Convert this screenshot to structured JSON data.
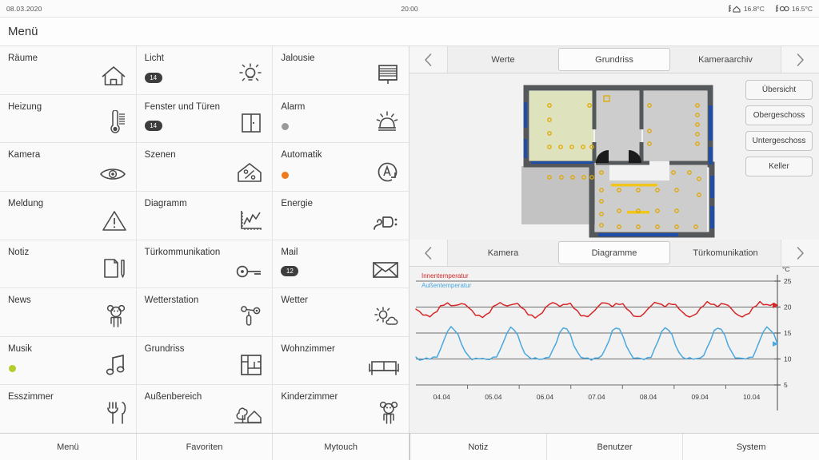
{
  "statusbar": {
    "date": "08.03.2020",
    "clock": "20:00",
    "sensors": [
      {
        "icon": "house-temp-icon",
        "value": "16.8°C"
      },
      {
        "icon": "outdoor-temp-icon",
        "value": "16.5°C"
      }
    ]
  },
  "header": {
    "title": "Menü"
  },
  "menu": {
    "columns": [
      {
        "items": [
          {
            "label": "Räume",
            "icon": "house-icon"
          },
          {
            "label": "Heizung",
            "icon": "thermometer-icon"
          },
          {
            "label": "Kamera",
            "icon": "eye-icon"
          },
          {
            "label": "Meldung",
            "icon": "warning-triangle-icon"
          },
          {
            "label": "Notiz",
            "icon": "note-pencil-icon"
          },
          {
            "label": "News",
            "icon": "teddy-bear-icon"
          },
          {
            "label": "Musik",
            "icon": "music-note-icon",
            "dot": "#b5cc2a"
          },
          {
            "label": "Esszimmer",
            "icon": "cutlery-icon"
          }
        ]
      },
      {
        "items": [
          {
            "label": "Licht",
            "icon": "lightbulb-icon",
            "badge": "14"
          },
          {
            "label": "Fenster und Türen",
            "icon": "window-icon",
            "badge": "14"
          },
          {
            "label": "Szenen",
            "icon": "house-percent-icon"
          },
          {
            "label": "Diagramm",
            "icon": "chart-icon"
          },
          {
            "label": "Türkommunikation",
            "icon": "key-icon"
          },
          {
            "label": "Wetterstation",
            "icon": "anemometer-icon"
          },
          {
            "label": "Grundriss",
            "icon": "floorplan-icon"
          },
          {
            "label": "Außenbereich",
            "icon": "tree-house-icon"
          }
        ]
      },
      {
        "items": [
          {
            "label": "Jalousie",
            "icon": "blinds-icon"
          },
          {
            "label": "Alarm",
            "icon": "alarm-bell-icon",
            "dot": "#9a9a9a"
          },
          {
            "label": "Automatik",
            "icon": "automatic-icon",
            "dot": "#f07a18"
          },
          {
            "label": "Energie",
            "icon": "power-plug-icon"
          },
          {
            "label": "Mail",
            "icon": "envelope-icon",
            "badge": "12"
          },
          {
            "label": "Wetter",
            "icon": "sun-cloud-icon"
          },
          {
            "label": "Wohnzimmer",
            "icon": "sofa-icon"
          },
          {
            "label": "Kinderzimmer",
            "icon": "teddy-bear-icon"
          }
        ]
      }
    ]
  },
  "top_panel": {
    "tabs": [
      {
        "label": "Werte",
        "active": false
      },
      {
        "label": "Grundriss",
        "active": true
      },
      {
        "label": "Kameraarchiv",
        "active": false
      }
    ],
    "prev_arrow": "chevron-left-icon",
    "next_arrow": "chevron-right-icon",
    "floor_buttons": [
      {
        "label": "Übersicht"
      },
      {
        "label": "Obergeschoss"
      },
      {
        "label": "Untergeschoss"
      },
      {
        "label": "Keller"
      }
    ],
    "plan": {
      "wall_color": "#55585a",
      "room_fill": "#cdcdcd",
      "room_active_fill": "#dfe3bd",
      "light_marker_color": "#e0a800",
      "window_color": "#1f4ea8",
      "strip_color": "#f0c61e"
    }
  },
  "bottom_panel": {
    "tabs": [
      {
        "label": "Kamera",
        "active": false
      },
      {
        "label": "Diagramme",
        "active": true
      },
      {
        "label": "Türkomunikation",
        "active": false
      }
    ],
    "prev_arrow": "chevron-left-icon",
    "next_arrow": "chevron-right-icon"
  },
  "chart_data": {
    "type": "line",
    "title": "",
    "xlabel": "",
    "ylabel": "°C",
    "unit_label": "°C",
    "legend_position": "top-left",
    "grid": true,
    "ylim": [
      5,
      25
    ],
    "yticks": [
      5,
      10,
      15,
      20,
      25
    ],
    "xticks": [
      "04.04",
      "05.04",
      "06.04",
      "07.04",
      "08.04",
      "09.04",
      "10.04"
    ],
    "series": [
      {
        "name": "Innentemperatur",
        "color": "#d62728",
        "values": [
          19.6,
          19.2,
          18.6,
          18.3,
          18.2,
          18.6,
          19.4,
          20.1,
          20.5,
          20.6,
          20.4,
          20.3,
          20.5,
          20.6,
          20.4,
          20.0,
          19.3,
          18.6,
          18.2,
          18.1,
          18.4,
          19.2,
          20.0,
          20.5,
          20.7,
          20.5,
          20.3,
          20.4,
          20.6,
          20.5,
          20.1,
          19.4,
          18.7,
          18.2,
          18.0,
          18.3,
          19.1,
          19.9,
          20.5,
          20.8,
          20.6,
          20.3,
          20.4,
          20.6,
          20.5,
          20.0,
          19.2,
          18.5,
          18.1,
          18.2,
          18.7,
          19.5,
          20.2,
          20.7,
          20.8,
          20.5,
          20.3,
          20.5,
          20.6,
          20.4,
          19.9,
          19.1,
          18.4,
          18.0,
          18.2,
          18.8,
          19.6,
          20.3,
          20.7,
          20.8,
          20.4,
          20.3,
          20.5,
          20.6,
          20.3,
          19.8,
          19.0,
          18.4,
          18.0,
          18.3,
          18.9,
          19.7,
          20.4,
          20.8,
          20.7,
          20.4,
          20.3,
          20.5,
          20.6,
          20.2,
          19.7,
          18.9,
          18.3,
          18.1,
          18.4,
          19.0,
          19.8,
          20.4,
          20.8,
          20.6,
          20.4,
          20.5,
          20.6,
          20.3
        ]
      },
      {
        "name": "Außentemperatur",
        "color": "#4aa8df",
        "values": [
          10.2,
          10.0,
          9.9,
          10.1,
          10.0,
          10.2,
          10.6,
          11.8,
          13.6,
          15.3,
          16.1,
          15.8,
          14.6,
          12.9,
          11.4,
          10.5,
          10.1,
          10.0,
          10.1,
          10.0,
          9.9,
          10.1,
          10.2,
          10.5,
          11.6,
          13.4,
          15.2,
          16.0,
          15.7,
          14.4,
          12.7,
          11.2,
          10.4,
          10.1,
          10.0,
          10.1,
          10.0,
          10.2,
          10.4,
          11.5,
          13.3,
          15.1,
          16.0,
          15.8,
          14.5,
          12.8,
          11.3,
          10.4,
          10.1,
          10.0,
          10.0,
          10.1,
          10.3,
          10.6,
          11.9,
          13.7,
          15.4,
          16.1,
          15.6,
          14.3,
          12.6,
          11.1,
          10.3,
          10.0,
          10.1,
          10.0,
          10.2,
          10.5,
          11.7,
          13.5,
          15.3,
          16.0,
          15.7,
          14.4,
          12.7,
          11.2,
          10.4,
          10.1,
          10.0,
          10.1,
          10.0,
          10.3,
          10.7,
          12.0,
          13.8,
          15.4,
          16.1,
          15.7,
          14.4,
          12.7,
          11.2,
          10.4,
          10.1,
          10.0,
          10.1,
          10.2,
          10.6,
          11.8,
          13.6,
          15.3,
          16.1,
          15.8,
          14.6,
          12.9
        ]
      }
    ]
  },
  "bottomnav": {
    "items": [
      {
        "label": "Menü"
      },
      {
        "label": "Favoriten"
      },
      {
        "label": "Mytouch"
      },
      {
        "label": "Notiz"
      },
      {
        "label": "Benutzer"
      },
      {
        "label": "System"
      }
    ]
  }
}
